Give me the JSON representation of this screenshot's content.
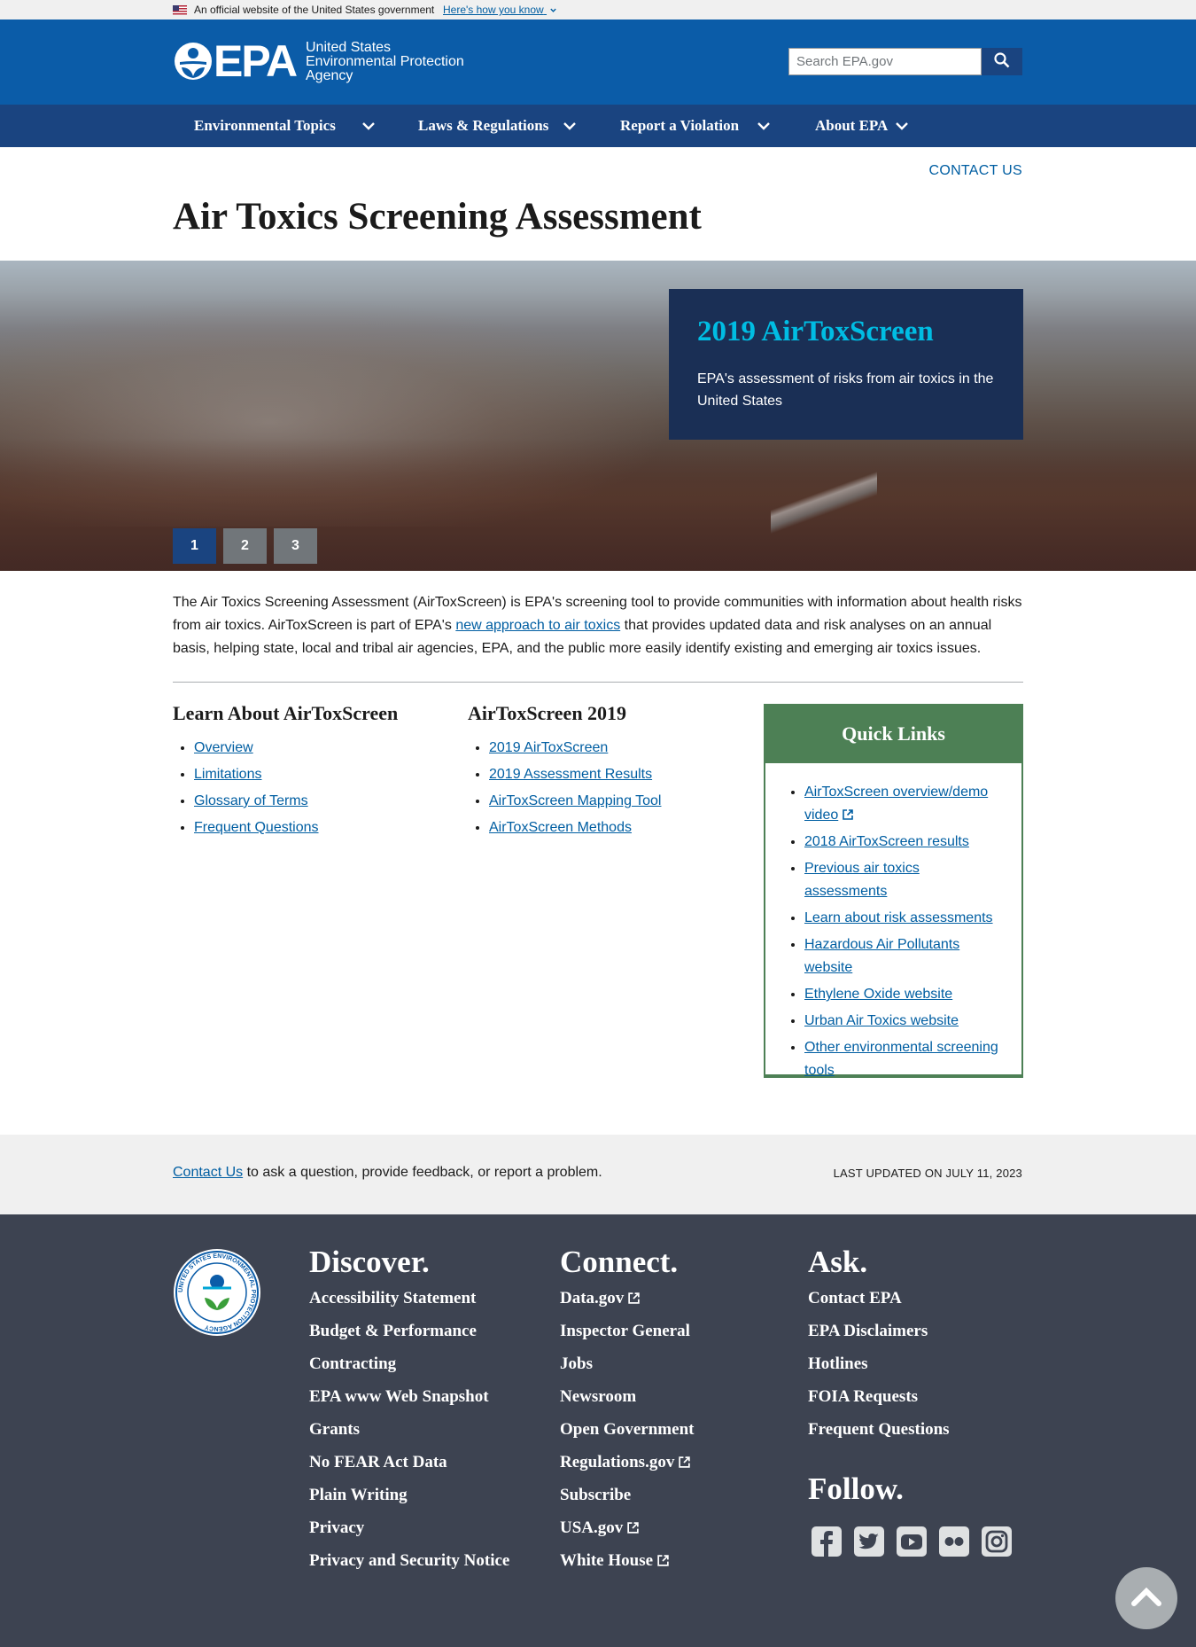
{
  "gov_banner": {
    "text": "An official website of the United States government",
    "how_link": "Here's how you know"
  },
  "header": {
    "logo_word": "EPA",
    "agency_line1": "United States",
    "agency_line2": "Environmental Protection",
    "agency_line3": "Agency",
    "search_placeholder": "Search EPA.gov"
  },
  "nav": {
    "items": [
      {
        "label": "Environmental Topics"
      },
      {
        "label": "Laws & Regulations"
      },
      {
        "label": "Report a Violation"
      },
      {
        "label": "About EPA"
      }
    ]
  },
  "page": {
    "contact_link": "CONTACT US",
    "title": "Air Toxics Screening Assessment"
  },
  "hero": {
    "title": "2019 AirToxScreen",
    "description": "EPA's assessment of risks from air toxics in the United States",
    "slides": [
      "1",
      "2",
      "3"
    ],
    "active_slide": 1
  },
  "intro": {
    "part1": "The Air Toxics Screening Assessment (AirToxScreen) is EPA's screening tool to provide communities with information about health risks from air toxics. AirToxScreen is part of EPA's ",
    "link": "new approach to air toxics",
    "part2": " that provides updated data and risk analyses on an annual basis, helping state, local and tribal air agencies, EPA, and the public more easily identify existing and emerging air toxics issues."
  },
  "learn": {
    "heading": "Learn About AirToxScreen",
    "links": [
      "Overview",
      "Limitations",
      "Glossary of Terms",
      "Frequent Questions"
    ]
  },
  "airtox2019": {
    "heading": "AirToxScreen 2019",
    "links": [
      "2019 AirToxScreen",
      "2019 Assessment Results",
      "AirToxScreen Mapping Tool",
      "AirToxScreen Methods"
    ]
  },
  "quick_links": {
    "heading": "Quick Links",
    "links": [
      "AirToxScreen overview/demo video",
      "2018 AirToxScreen results",
      "Previous air toxics assessments",
      "Learn about risk assessments",
      "Hazardous Air Pollutants website",
      "Ethylene Oxide website",
      "Urban Air Toxics website",
      "Other environmental screening tools"
    ]
  },
  "contact_bar": {
    "link": "Contact Us",
    "text": " to ask a question, provide feedback, or report a problem.",
    "last_updated": "LAST UPDATED ON JULY 11, 2023"
  },
  "footer": {
    "discover": {
      "heading": "Discover.",
      "links": [
        "Accessibility Statement",
        "Budget & Performance",
        "Contracting",
        "EPA www Web Snapshot",
        "Grants",
        "No FEAR Act Data",
        "Plain Writing",
        "Privacy",
        "Privacy and Security Notice"
      ]
    },
    "connect": {
      "heading": "Connect.",
      "links": [
        "Data.gov",
        "Inspector General",
        "Jobs",
        "Newsroom",
        "Open Government",
        "Regulations.gov",
        "Subscribe",
        "USA.gov",
        "White House"
      ]
    },
    "ask": {
      "heading": "Ask.",
      "links": [
        "Contact EPA",
        "EPA Disclaimers",
        "Hotlines",
        "FOIA Requests",
        "Frequent Questions"
      ]
    },
    "follow": {
      "heading": "Follow.",
      "icons": [
        "facebook-icon",
        "twitter-icon",
        "youtube-icon",
        "flickr-icon",
        "instagram-icon"
      ]
    },
    "seal_icon": "epa-seal",
    "seal_text": "UNITED STATES ENVIRONMENTAL PROTECTION AGENCY"
  },
  "colors": {
    "header_blue": "#0b5ca8",
    "nav_blue": "#1a4480",
    "hero_card": "#1a2f55",
    "hero_title": "#00bde3",
    "quick_links_green": "#4d8055",
    "footer_bg": "#3d4351",
    "link": "#005ea2"
  }
}
